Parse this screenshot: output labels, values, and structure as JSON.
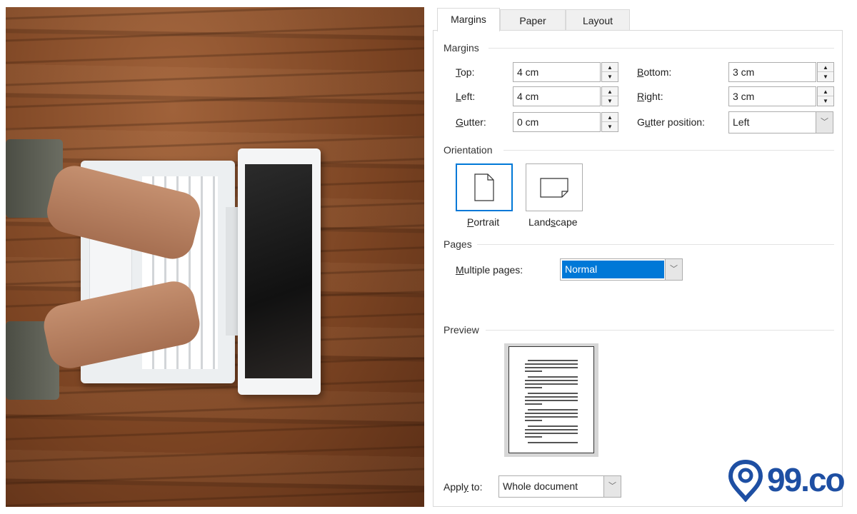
{
  "tabs": [
    {
      "label": "Margins",
      "selected": true
    },
    {
      "label": "Paper"
    },
    {
      "label": "Layout"
    }
  ],
  "margins": {
    "group_label": "Margins",
    "top": {
      "label_u": "T",
      "label_rest": "op:",
      "value": "4 cm"
    },
    "bottom": {
      "label_u": "B",
      "label_rest": "ottom:",
      "value": "3 cm"
    },
    "left": {
      "label_u": "L",
      "label_rest": "eft:",
      "value": "4 cm"
    },
    "right": {
      "label_u": "R",
      "label_rest": "ight:",
      "value": "3 cm"
    },
    "gutter": {
      "label_u": "G",
      "label_rest": "utter:",
      "value": "0 cm"
    },
    "gutter_position": {
      "label_pre": "G",
      "label_u": "u",
      "label_rest": "tter position:",
      "value": "Left"
    }
  },
  "orientation": {
    "group_label": "Orientation",
    "portrait": {
      "label_u": "P",
      "label_rest": "ortrait",
      "selected": true
    },
    "landscape": {
      "label_pre": "Land",
      "label_u": "s",
      "label_rest": "cape"
    }
  },
  "pages": {
    "group_label": "Pages",
    "multiple_label_u": "M",
    "multiple_label_rest": "ultiple pages:",
    "value": "Normal"
  },
  "preview": {
    "group_label": "Preview"
  },
  "apply_to": {
    "label_pre": "Appl",
    "label_u": "y",
    "label_rest": " to:",
    "value": "Whole document"
  },
  "logo": {
    "text": "99.co",
    "color": "#1e4fa3"
  },
  "colors": {
    "accent": "#0078d7",
    "highlight": "#0078d7"
  }
}
